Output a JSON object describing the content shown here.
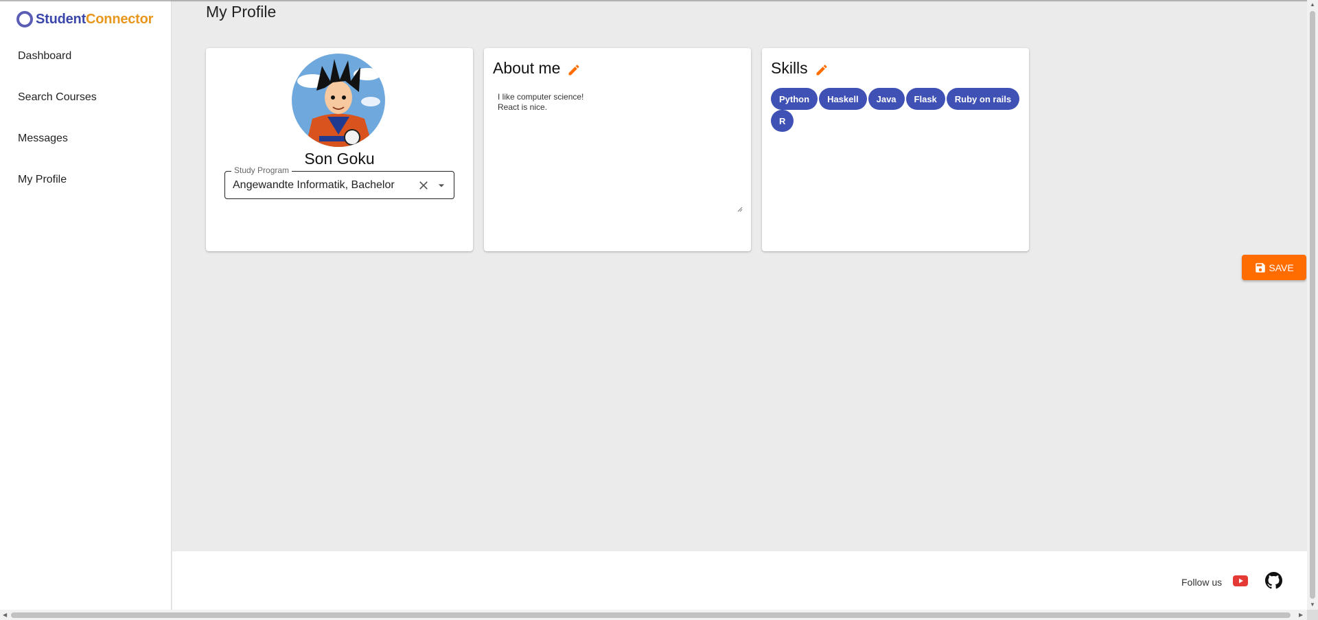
{
  "app": {
    "logo_part1": "Student",
    "logo_part2": "Connector"
  },
  "nav": {
    "items": [
      {
        "label": "Dashboard"
      },
      {
        "label": "Search Courses"
      },
      {
        "label": "Messages"
      },
      {
        "label": "My Profile"
      }
    ]
  },
  "page": {
    "title": "My Profile"
  },
  "profile": {
    "name": "Son Goku",
    "study_program_label": "Study Program",
    "study_program_value": "Angewandte Informatik, Bachelor"
  },
  "about": {
    "title": "About me",
    "text": "I like computer science!\nReact is nice."
  },
  "skills": {
    "title": "Skills",
    "items": [
      "Python",
      "Haskell",
      "Java",
      "Flask",
      "Ruby on rails",
      "R"
    ]
  },
  "actions": {
    "save_label": "SAVE"
  },
  "footer": {
    "follow_label": "Follow us"
  },
  "colors": {
    "accent_orange": "#ff6d00",
    "chip_blue": "#3f51b5",
    "logo_blue": "#3a46a9",
    "logo_orange": "#e8961c"
  },
  "icons": {
    "edit": "pencil-icon",
    "save": "floppy-disk-icon",
    "clear": "close-icon",
    "dropdown": "caret-down-icon",
    "youtube": "youtube-icon",
    "github": "github-icon"
  }
}
